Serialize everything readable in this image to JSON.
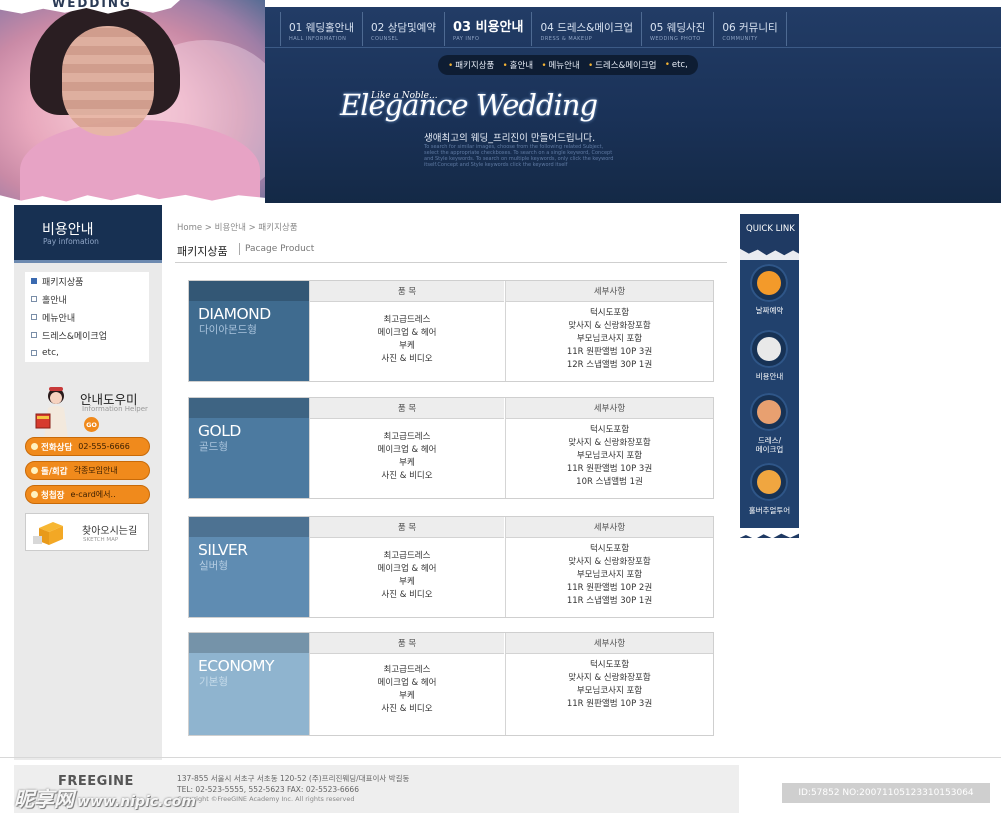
{
  "header": {
    "logo": "WEDDING",
    "gnb": [
      {
        "label": "01 웨딩홀안내",
        "sub": "HALL INFORMATION",
        "active": false
      },
      {
        "label": "02 상담및예약",
        "sub": "COUNSEL",
        "active": false
      },
      {
        "label": "03 비용안내",
        "sub": "PAY INFO",
        "active": true
      },
      {
        "label": "04 드레스&메이크업",
        "sub": "DRESS & MAKEUP",
        "active": false
      },
      {
        "label": "05 웨딩사진",
        "sub": "WEDDING PHOTO",
        "active": false
      },
      {
        "label": "06 커뮤니티",
        "sub": "COMMUNITY",
        "active": false
      }
    ],
    "subnav": [
      "패키지상품",
      "홀안내",
      "메뉴안내",
      "드레스&메이크업",
      "etc,"
    ],
    "script_small": "Like a Noble...",
    "script_title": "Elegance Wedding",
    "tagline": "생애최고의 웨딩_프리진이 만들어드립니다.",
    "desc": "To search for similar images, choose from the following related Subject, select the appropriate checkboxes. To search on a single keyword, Concept and Style keywords. To search on multiple keywords, only click the keyword itself.Concept and Style keywords click the keyword itself"
  },
  "sidebar": {
    "section_title": "비용안내",
    "section_sub": "Pay infomation",
    "menu": [
      {
        "label": "패키지상품",
        "active": true
      },
      {
        "label": "홀안내",
        "active": false
      },
      {
        "label": "메뉴안내",
        "active": false
      },
      {
        "label": "드레스&메이크업",
        "active": false
      },
      {
        "label": "etc,",
        "active": false
      }
    ],
    "helper_title": "안내도우미",
    "helper_sub": "Information Helper",
    "go": "GO",
    "buttons": [
      {
        "label": "전화상담",
        "value": "02-555-6666"
      },
      {
        "label": "돌/회갑",
        "value": "각종모임안내"
      },
      {
        "label": "청첩장",
        "value": "e-card에서.."
      }
    ],
    "map_title": "찾아오시는길",
    "map_sub": "SKETCH MAP"
  },
  "content": {
    "breadcrumb": "Home > 비용안내 > 패키지상품",
    "title": "패키지상품",
    "title_en": "Pacage Product",
    "col_item": "품 목",
    "col_detail": "세부사항",
    "packages": [
      {
        "en": "DIAMOND",
        "ko": "다이아몬드형",
        "items": [
          "최고급드레스",
          "메이크업 & 헤어",
          "부케",
          "사진 & 비디오"
        ],
        "details": [
          "턱시도포함",
          "맞사지 & 신랑화장포함",
          "부모님코사지 포함",
          "11R 원판앨범 10P 3권",
          "12R 스냅앨범 30P 1권"
        ]
      },
      {
        "en": "GOLD",
        "ko": "골드형",
        "items": [
          "최고급드레스",
          "메이크업 & 헤어",
          "부케",
          "사진 & 비디오"
        ],
        "details": [
          "턱시도포함",
          "맞사지 & 신랑화장포함",
          "부모님코사지 포함",
          "11R 원판앨범 10P 3권",
          "10R 스냅앨범 1권"
        ]
      },
      {
        "en": "SILVER",
        "ko": "실버형",
        "items": [
          "최고급드레스",
          "메이크업 & 헤어",
          "부케",
          "사진 & 비디오"
        ],
        "details": [
          "턱시도포함",
          "맞사지 & 신랑화장포함",
          "부모님코사지 포함",
          "11R 원판앨범 10P 2권",
          "11R 스냅앨범 30P 1권"
        ]
      },
      {
        "en": "ECONOMY",
        "ko": "기본형",
        "items": [
          "최고급드레스",
          "메이크업 & 헤어",
          "부케",
          "사진 & 비디오"
        ],
        "details": [
          "턱시도포함",
          "맞사지 & 신랑화장포함",
          "부모님코사지 포함",
          "11R 원판앨범 10P 3권"
        ]
      }
    ]
  },
  "quicklink": {
    "title": "QUICK LINK",
    "items": [
      {
        "label": "날짜예약",
        "icon": "clock-icon",
        "color": "#f39a2a"
      },
      {
        "label": "비용안내",
        "icon": "wallet-icon",
        "color": "#e9e9e9"
      },
      {
        "label": "드레스/\n메이크업",
        "icon": "people-icon",
        "color": "#e8a070"
      },
      {
        "label": "홀버추얼투어",
        "icon": "house-icon",
        "color": "#f0a640"
      }
    ]
  },
  "footer": {
    "logo": "FREEGINE",
    "address": "137-855 서울시 서초구 서초동 120-52 (주)프리진웨딩/대표이사 박길동",
    "tel": "TEL: 02-523-5555, 552-5623   FAX: 02-5523-6666",
    "copyright": "Copyright ©FreeGINE Academy Inc. All rights reserved",
    "watermark_left": "昵享网",
    "watermark_url": "www.nipic.com",
    "watermark_right": "ID:57852 NO:20071105123310153064"
  },
  "colors": {
    "header_bg": "#1a3258",
    "accent_orange": "#f08a1c",
    "diamond": "#3f6b8f",
    "gold": "#4c7aa0",
    "silver": "#5f8cb2",
    "economy": "#8fb4cf"
  }
}
